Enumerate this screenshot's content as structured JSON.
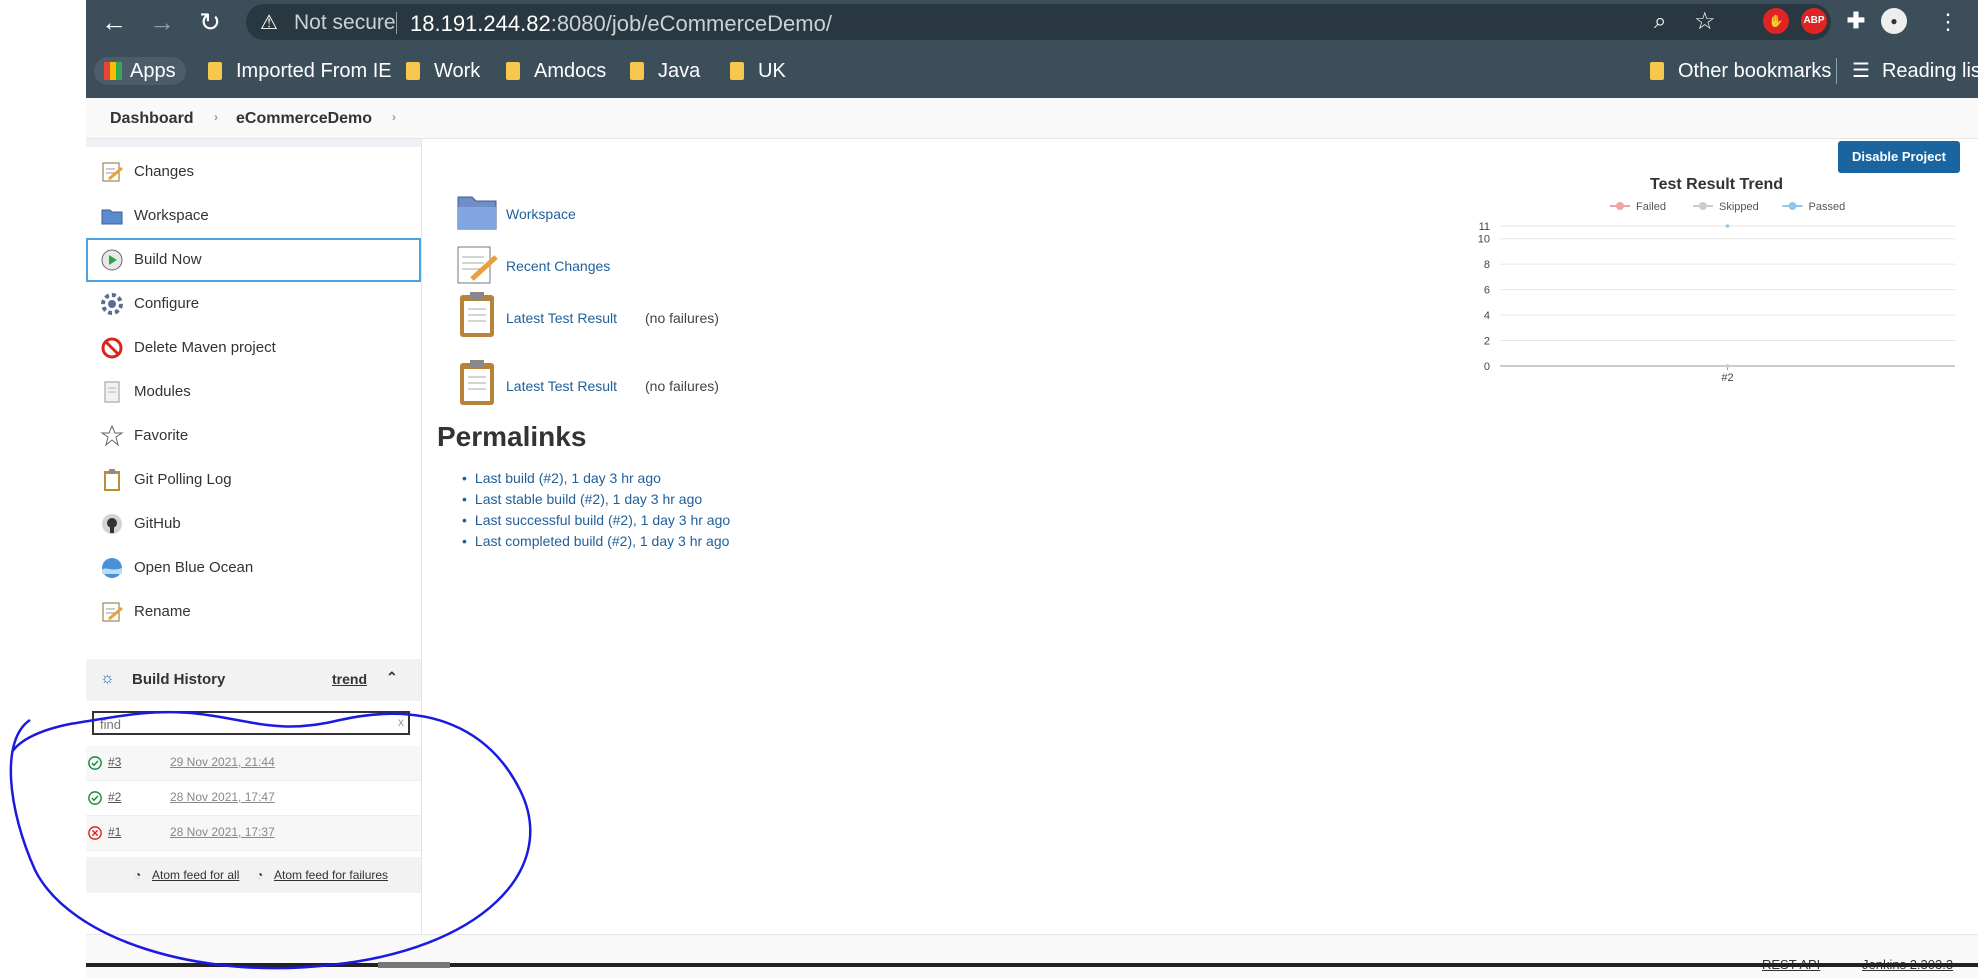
{
  "browser": {
    "security_label": "Not secure",
    "url_host": "18.191.244.82",
    "url_rest": ":8080/job/eCommerceDemo/",
    "abp_label": "ABP",
    "bookmarks": {
      "apps": "Apps",
      "imported": "Imported From IE",
      "work": "Work",
      "amdocs": "Amdocs",
      "java": "Java",
      "uk": "UK",
      "other": "Other bookmarks",
      "reading": "Reading list"
    }
  },
  "breadcrumb": {
    "dashboard": "Dashboard",
    "project": "eCommerceDemo"
  },
  "sidebar": {
    "changes": "Changes",
    "workspace": "Workspace",
    "build_now": "Build Now",
    "configure": "Configure",
    "delete": "Delete Maven project",
    "modules": "Modules",
    "favorite": "Favorite",
    "git_polling": "Git Polling Log",
    "github": "GitHub",
    "blue_ocean": "Open Blue Ocean",
    "rename": "Rename"
  },
  "build_history": {
    "title": "Build History",
    "trend": "trend",
    "find_placeholder": "find",
    "clear": "x",
    "builds": [
      {
        "number": "#3",
        "date": "29 Nov 2021, 21:44",
        "status": "success"
      },
      {
        "number": "#2",
        "date": "28 Nov 2021, 17:47",
        "status": "success"
      },
      {
        "number": "#1",
        "date": "28 Nov 2021, 17:37",
        "status": "failed"
      }
    ],
    "atom_all": "Atom feed for all",
    "atom_failures": "Atom feed for failures"
  },
  "main": {
    "disable_button": "Disable Project",
    "workspace": "Workspace",
    "recent_changes": "Recent Changes",
    "latest_test": "Latest Test Result",
    "no_failures": "(no failures)",
    "permalinks_title": "Permalinks",
    "permalinks": [
      "Last build (#2), 1 day 3 hr ago",
      "Last stable build (#2), 1 day 3 hr ago",
      "Last successful build (#2), 1 day 3 hr ago",
      "Last completed build (#2), 1 day 3 hr ago"
    ]
  },
  "chart_data": {
    "type": "line",
    "title": "Test Result Trend",
    "categories": [
      "#2"
    ],
    "series": [
      {
        "name": "Failed",
        "color": "#f4a2a2",
        "values": [
          0
        ]
      },
      {
        "name": "Skipped",
        "color": "#cccccc",
        "values": [
          0
        ]
      },
      {
        "name": "Passed",
        "color": "#8fc7ee",
        "values": [
          11
        ]
      }
    ],
    "y_ticks": [
      "11",
      "10",
      "8",
      "6",
      "4",
      "2",
      "0"
    ],
    "ylim": [
      0,
      11
    ],
    "grid": true,
    "legend": "top"
  },
  "footer": {
    "rest_api": "REST API",
    "version": "Jenkins 2.303.3"
  }
}
